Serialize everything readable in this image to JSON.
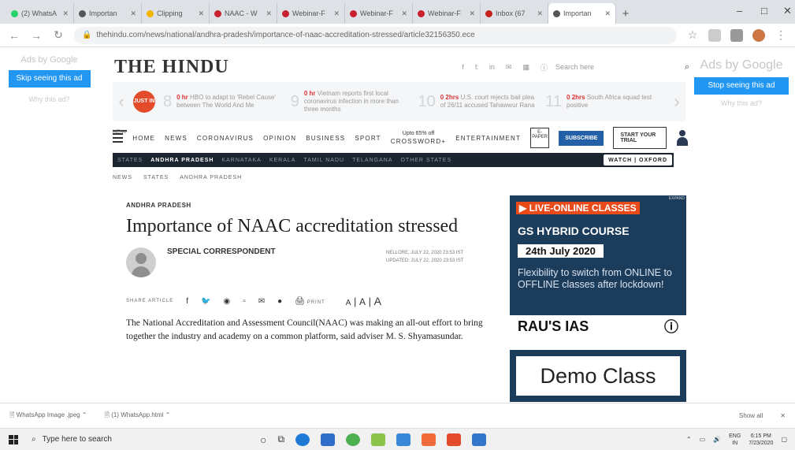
{
  "browser": {
    "tabs": [
      {
        "label": "(2) WhatsA",
        "color": "#25d366"
      },
      {
        "label": "Importan",
        "color": "#555555"
      },
      {
        "label": "Clipping",
        "color": "#f2b400"
      },
      {
        "label": "NAAC - W",
        "color": "#c8202f"
      },
      {
        "label": "Webinar-F",
        "color": "#c8202f"
      },
      {
        "label": "Webinar-F",
        "color": "#c8202f"
      },
      {
        "label": "Webinar-F",
        "color": "#c8202f"
      },
      {
        "label": "Inbox (67",
        "color": "#c5221f"
      },
      {
        "label": "Importan",
        "color": "#555555"
      }
    ],
    "url": "thehindu.com/news/national/andhra-pradesh/importance-of-naac-accreditation-stressed/article32156350.ece"
  },
  "ads": {
    "left": {
      "adsby": "Ads by Google",
      "skip": "Skip seeing this ad",
      "why": "Why this ad?"
    },
    "right": {
      "adsby": "Ads by Google",
      "skip": "Stop seeing this ad",
      "why": "Why this ad?"
    }
  },
  "masthead": {
    "logo": "THE HINDU",
    "search_placeholder": "Search here"
  },
  "ticker": {
    "just_in": "JUST IN",
    "items": [
      {
        "num": "8",
        "time": "0 hr",
        "text": "HBO to adapt to 'Rebel Cause' between The World And Me"
      },
      {
        "num": "9",
        "time": "0 hr",
        "text": "Vietnam reports first local coronavirus infection in more than three months"
      },
      {
        "num": "10",
        "time": "0 2hrs",
        "text": "U.S. court rejects bail plea of 26/11 accused Tahawwur Rana"
      },
      {
        "num": "11",
        "time": "0 2hrs",
        "text": "South Africa squad test positive"
      }
    ]
  },
  "nav": {
    "menu_label": "MENU",
    "items": [
      "HOME",
      "NEWS",
      "CORONAVIRUS",
      "OPINION",
      "BUSINESS",
      "SPORT",
      "CROSSWORD+",
      "ENTERTAINMENT"
    ],
    "promo": "Upto 65% off",
    "epaper": "E-PAPER",
    "subscribe": "SUBSCRIBE",
    "trial": "START YOUR TRIAL"
  },
  "states": {
    "items": [
      "STATES",
      "ANDHRA PRADESH",
      "KARNATAKA",
      "KERALA",
      "TAMIL NADU",
      "TELANGANA",
      "OTHER STATES"
    ],
    "active_index": 1,
    "watch": "WATCH | OXFORD"
  },
  "breadcrumb": [
    "NEWS",
    "STATES",
    "ANDHRA PRADESH"
  ],
  "article": {
    "section": "ANDHRA PRADESH",
    "headline": "Importance of NAAC accreditation stressed",
    "author": "SPECIAL CORRESPONDENT",
    "dateline": "NELLORE, JULY 22, 2020 23:53 IST",
    "updated": "UPDATED: JULY 22, 2020 23:53 IST",
    "share_label": "SHARE ARTICLE",
    "print_label": "PRINT",
    "font_sizes": [
      "A",
      "A",
      "A"
    ],
    "body": "The National Accreditation and Assessment Council(NAAC) was making an all-out effort to bring together the industry and academy on a common platform, said adviser M. S. Shyamasundar."
  },
  "ad_ias": {
    "expand": "EXPAND",
    "live": "▶ LIVE-ONLINE CLASSES",
    "course": "GS HYBRID COURSE",
    "date": "24th July 2020",
    "flex": "Flexibility to switch from ONLINE to OFFLINE classes after lockdown!",
    "brand": "RAU'S IAS"
  },
  "ad_demo": "Demo Class",
  "downloads": {
    "items": [
      "WhatsApp Image .jpeg",
      "(1) WhatsApp.html"
    ],
    "show_all": "Show all"
  },
  "taskbar": {
    "search_placeholder": "Type here to search",
    "lang": "ENG",
    "region": "IN",
    "time": "6:15 PM",
    "date": "7/23/2020"
  }
}
